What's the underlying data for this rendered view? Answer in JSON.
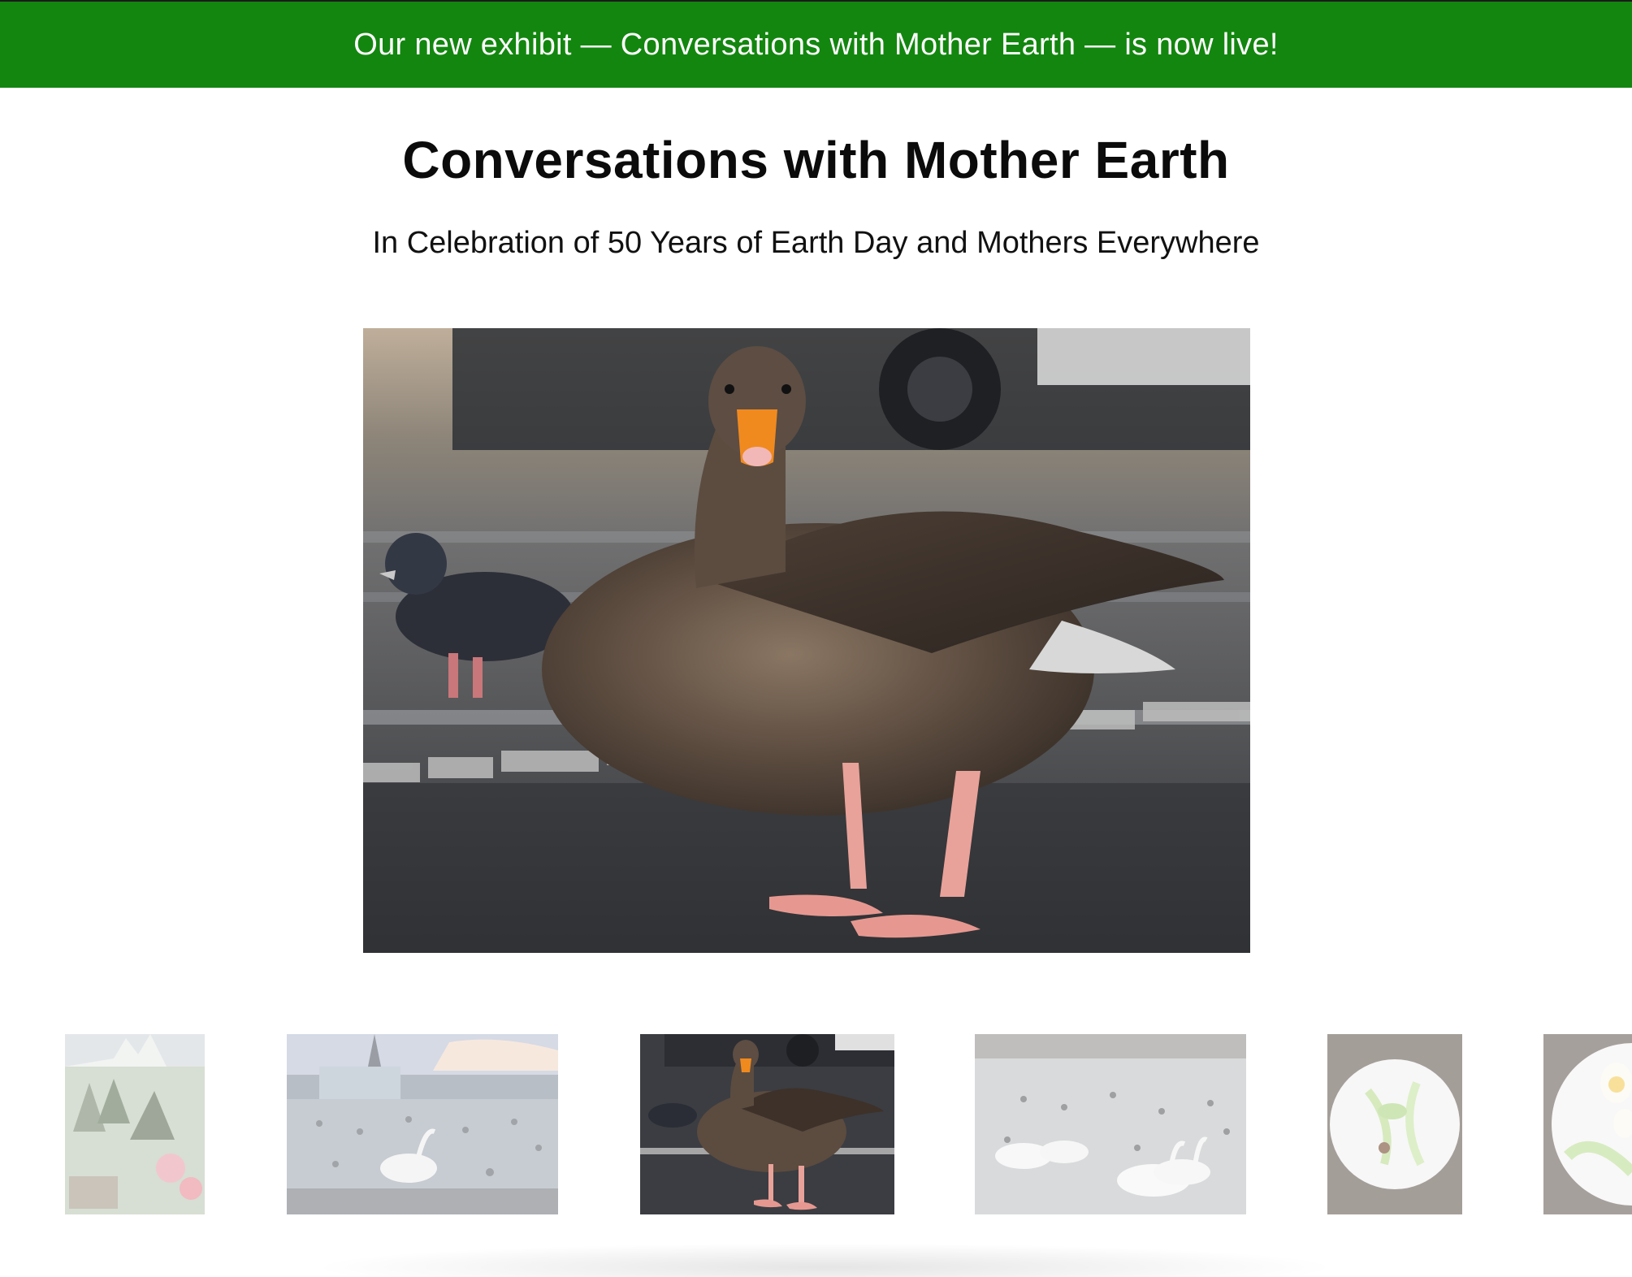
{
  "banner": {
    "text": "Our new exhibit — Conversations with Mother Earth — is now live!",
    "color": "#13860f"
  },
  "exhibit": {
    "title": "Conversations with Mother Earth",
    "subtitle": "In Celebration of 50 Years of Earth Day and Mothers Everywhere"
  },
  "gallery": {
    "main_image": "goose-on-pavement-photo",
    "thumbnails": [
      {
        "image": "botanical-garden-illustration",
        "selected": false
      },
      {
        "image": "swan-at-lake-with-church-photo",
        "selected": false
      },
      {
        "image": "goose-on-pavement-photo",
        "selected": true
      },
      {
        "image": "swans-on-water-photo",
        "selected": false
      },
      {
        "image": "cucumber-mantis-plate-photo",
        "selected": false
      },
      {
        "image": "egg-cucumber-plate-photo",
        "selected": false
      }
    ]
  }
}
